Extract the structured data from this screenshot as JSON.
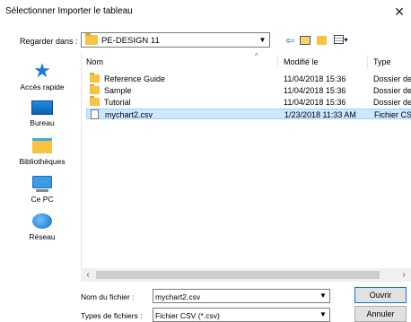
{
  "window": {
    "title": "Sélectionner Importer le tableau",
    "close_glyph": "✕"
  },
  "lookin": {
    "label": "Regarder dans :",
    "value": "PE-DESIGN 11"
  },
  "toolbar": {
    "back_icon": "back-arrow-icon",
    "up_icon": "up-folder-icon",
    "new_icon": "new-folder-icon",
    "view_icon": "view-menu-icon"
  },
  "places": [
    {
      "label": "Accès rapide",
      "icon": "star-icon"
    },
    {
      "label": "Bureau",
      "icon": "desktop-icon"
    },
    {
      "label": "Bibliothèques",
      "icon": "libraries-icon"
    },
    {
      "label": "Ce PC",
      "icon": "computer-icon"
    },
    {
      "label": "Réseau",
      "icon": "network-icon"
    }
  ],
  "columns": {
    "name": "Nom",
    "date": "Modifié le",
    "type": "Type"
  },
  "files": [
    {
      "name": "Reference Guide",
      "date": "11/04/2018 15:36",
      "type": "Dossier de",
      "kind": "folder"
    },
    {
      "name": "Sample",
      "date": "11/04/2018 15:36",
      "type": "Dossier de",
      "kind": "folder"
    },
    {
      "name": "Tutorial",
      "date": "11/04/2018 15:36",
      "type": "Dossier de",
      "kind": "folder"
    },
    {
      "name": "mychart2.csv",
      "date": "1/23/2018 11:33 AM",
      "type": "Fichier CSV",
      "kind": "file",
      "selected": true
    }
  ],
  "filename": {
    "label": "Nom du fichier :",
    "value": "mychart2.csv"
  },
  "filetype": {
    "label": "Types de fichiers :",
    "value": "Fichier CSV (*.csv)"
  },
  "buttons": {
    "open": "Ouvrir",
    "cancel": "Annuler"
  },
  "colors": {
    "selection": "#cce8ff",
    "selection_border": "#99d1ff",
    "folder": "#f6c342",
    "accent": "#0078d7"
  }
}
